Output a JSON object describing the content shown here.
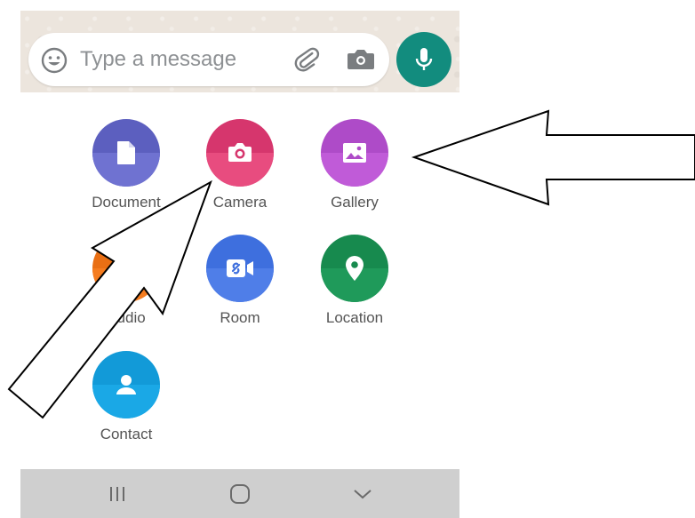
{
  "composer": {
    "placeholder": "Type a message",
    "icons": [
      "emoji-icon",
      "paperclip-icon",
      "camera-icon",
      "microphone-icon"
    ],
    "accent_color": "#128c7e"
  },
  "attachments": [
    {
      "label": "Document",
      "icon": "document-icon",
      "color_top": "#5c5fbf",
      "color_bottom": "#6f72d1"
    },
    {
      "label": "Camera",
      "icon": "camera-icon",
      "color_top": "#d6366d",
      "color_bottom": "#e84c7f"
    },
    {
      "label": "Gallery",
      "icon": "image-icon",
      "color_top": "#ae4bc8",
      "color_bottom": "#c05bd8"
    },
    {
      "label": "Audio",
      "icon": "headphones-icon",
      "color_top": "#e96f14",
      "color_bottom": "#f57c1f"
    },
    {
      "label": "Room",
      "icon": "video-link-icon",
      "color_top": "#3e6fde",
      "color_bottom": "#4f7ee8"
    },
    {
      "label": "Location",
      "icon": "location-pin-icon",
      "color_top": "#178a4e",
      "color_bottom": "#1f9a5a"
    },
    {
      "label": "Contact",
      "icon": "person-icon",
      "color_top": "#129ad8",
      "color_bottom": "#1aa8e6"
    }
  ],
  "navbar": {
    "buttons": [
      "recents-icon",
      "home-icon",
      "back-icon"
    ],
    "background": "#cfcfcf"
  }
}
